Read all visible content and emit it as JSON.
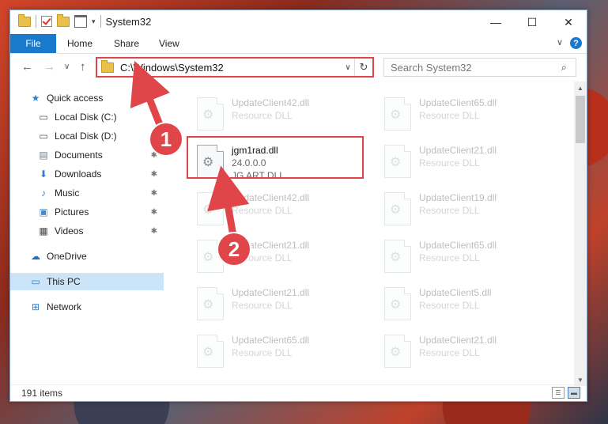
{
  "window": {
    "title": "System32",
    "controls": {
      "minimize": "—",
      "maximize": "☐",
      "close": "✕"
    }
  },
  "ribbon": {
    "file": "File",
    "tabs": [
      "Home",
      "Share",
      "View"
    ],
    "help_glyph": "?",
    "chevron": "∨"
  },
  "nav": {
    "back": "←",
    "forward": "→",
    "recent": "∨",
    "up": "↑",
    "address": "C:\\Windows\\System32",
    "address_dropdown": "∨",
    "refresh_glyph": "↻",
    "search_placeholder": "Search System32",
    "search_glyph": "⌕"
  },
  "sidebar": {
    "items": [
      {
        "label": "Quick access",
        "icon": "star-icon",
        "glyph": "★",
        "color": "#2d7fd3",
        "pinned": false
      },
      {
        "label": "Local Disk (C:)",
        "icon": "drive-icon",
        "glyph": "▭",
        "color": "#555555",
        "pinned": false
      },
      {
        "label": "Local Disk (D:)",
        "icon": "drive-icon",
        "glyph": "▭",
        "color": "#555555",
        "pinned": false
      },
      {
        "label": "Documents",
        "icon": "documents-icon",
        "glyph": "▤",
        "color": "#6d7b8a",
        "pinned": true
      },
      {
        "label": "Downloads",
        "icon": "downloads-icon",
        "glyph": "⬇",
        "color": "#2d7fd3",
        "pinned": true
      },
      {
        "label": "Music",
        "icon": "music-icon",
        "glyph": "♪",
        "color": "#2d7fd3",
        "pinned": true
      },
      {
        "label": "Pictures",
        "icon": "pictures-icon",
        "glyph": "▣",
        "color": "#4a8ac4",
        "pinned": true
      },
      {
        "label": "Videos",
        "icon": "videos-icon",
        "glyph": "▦",
        "color": "#444444",
        "pinned": true
      },
      {
        "label": "OneDrive",
        "icon": "onedrive-icon",
        "glyph": "☁",
        "color": "#1d6fc6",
        "pinned": false
      },
      {
        "label": "This PC",
        "icon": "computer-icon",
        "glyph": "▭",
        "color": "#2d7fd3",
        "pinned": false,
        "selected": true
      },
      {
        "label": "Network",
        "icon": "network-icon",
        "glyph": "⊞",
        "color": "#2d7fd3",
        "pinned": false
      }
    ],
    "pin_glyph": "📌"
  },
  "files": {
    "left": [
      {
        "name": "UpdateClient42.dll",
        "sub": "Resource DLL"
      },
      {
        "name": "jgm1rad.dll",
        "sub": "24.0.0.0",
        "sub2": "JG ART DLL",
        "highlight": true
      },
      {
        "name": "UpdateClient42.dll",
        "sub": "Resource DLL"
      },
      {
        "name": "UpdateClient21.dll",
        "sub": "Resource DLL"
      },
      {
        "name": "UpdateClient21.dll",
        "sub": "Resource DLL"
      },
      {
        "name": "UpdateClient65.dll",
        "sub": "Resource DLL"
      }
    ],
    "right": [
      {
        "name": "UpdateClient65.dll",
        "sub": "Resource DLL"
      },
      {
        "name": "UpdateClient21.dll",
        "sub": "Resource DLL"
      },
      {
        "name": "UpdateClient19.dll",
        "sub": "Resource DLL"
      },
      {
        "name": "UpdateClient65.dll",
        "sub": "Resource DLL"
      },
      {
        "name": "UpdateClient5.dll",
        "sub": "Resource DLL"
      },
      {
        "name": "UpdateClient21.dll",
        "sub": "Resource DLL"
      }
    ],
    "gear_glyph": "⚙"
  },
  "status": {
    "count": "191 items"
  },
  "annotations": {
    "callout_1": "1",
    "callout_2": "2",
    "color": "#e0454a"
  }
}
